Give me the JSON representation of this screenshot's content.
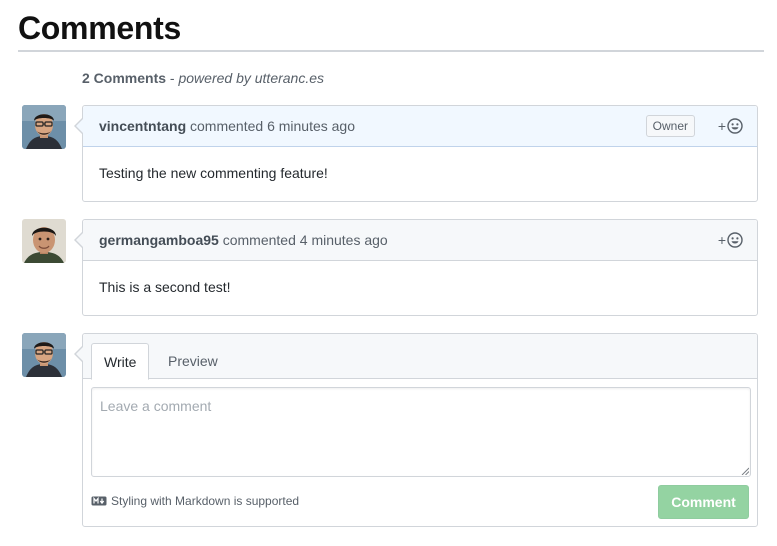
{
  "page": {
    "title": "Comments"
  },
  "summary": {
    "count": "2 Comments",
    "separator": " - ",
    "powered_by": "powered by utteranc.es"
  },
  "comments": [
    {
      "author": "vincentntang",
      "action": " commented ",
      "time": "6 minutes ago",
      "badge": "Owner",
      "body": "Testing the new commenting feature!",
      "avatar": "avatar-vincentntang",
      "reaction_icon": "smiley-icon"
    },
    {
      "author": "germangamboa95",
      "action": " commented ",
      "time": "4 minutes ago",
      "body": "This is a second test!",
      "avatar": "avatar-germangamboa95",
      "reaction_icon": "smiley-icon"
    }
  ],
  "reaction": {
    "plus": "+"
  },
  "new_comment": {
    "tabs": [
      {
        "label": "Write",
        "active": true
      },
      {
        "label": "Preview",
        "active": false
      }
    ],
    "placeholder": "Leave a comment",
    "value": "",
    "markdown_note": "Styling with Markdown is supported",
    "markdown_icon": "markdown-icon",
    "submit_label": "Comment"
  },
  "colors": {
    "owner_header_bg": "#f1f8ff",
    "header_bg": "#f6f8fa",
    "border": "#d1d5da",
    "submit_disabled": "#94d3a2"
  }
}
